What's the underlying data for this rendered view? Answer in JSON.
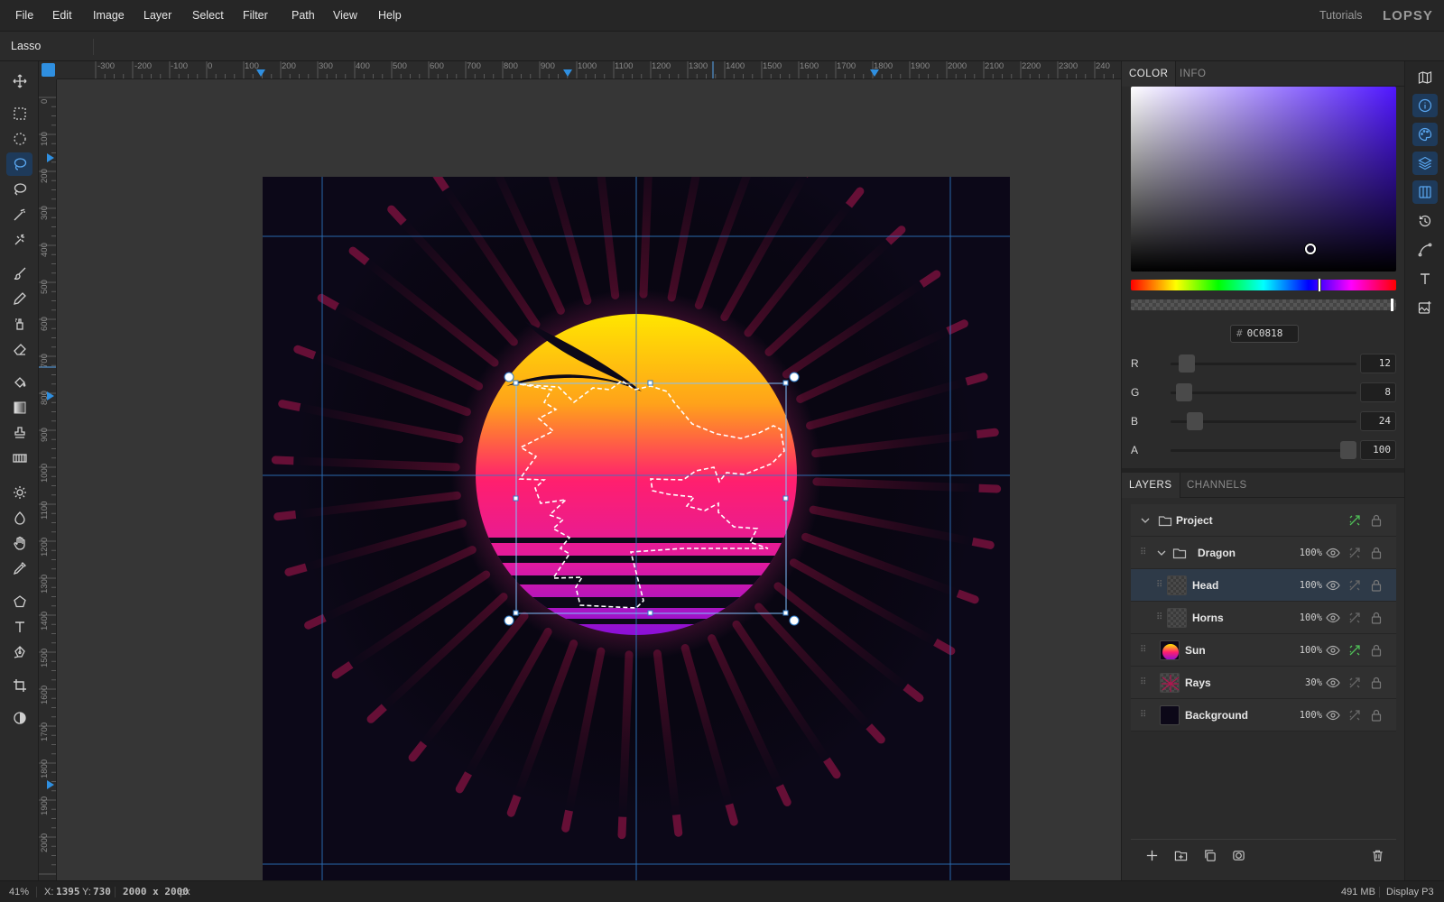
{
  "menu": {
    "items": [
      "File",
      "Edit",
      "Image",
      "Layer",
      "Select",
      "Filter",
      "Path",
      "View",
      "Help"
    ],
    "tutorials": "Tutorials",
    "brand": "LOPSY"
  },
  "options": {
    "tool_name": "Lasso"
  },
  "tools": [
    {
      "name": "move-tool",
      "icon": "move-icon"
    },
    {
      "name": "rect-select-tool",
      "icon": "rect-select-icon"
    },
    {
      "name": "ellipse-select-tool",
      "icon": "ellipse-select-icon"
    },
    {
      "name": "lasso-tool",
      "icon": "lasso-icon",
      "active": true
    },
    {
      "name": "magnetic-lasso-tool",
      "icon": "magnetic-lasso-icon"
    },
    {
      "name": "magic-wand-tool",
      "icon": "magic-wand-icon"
    },
    {
      "name": "quick-select-tool",
      "icon": "quick-select-icon"
    },
    {
      "name": "brush-tool",
      "icon": "brush-icon"
    },
    {
      "name": "pencil-tool",
      "icon": "pencil-icon"
    },
    {
      "name": "clone-tool",
      "icon": "clone-icon"
    },
    {
      "name": "eraser-tool",
      "icon": "eraser-icon"
    },
    {
      "name": "bucket-tool",
      "icon": "bucket-icon"
    },
    {
      "name": "gradient-tool",
      "icon": "gradient-icon"
    },
    {
      "name": "stamp-tool",
      "icon": "stamp-icon"
    },
    {
      "name": "pattern-tool",
      "icon": "pattern-icon"
    },
    {
      "name": "dodge-tool",
      "icon": "dodge-icon"
    },
    {
      "name": "burn-tool",
      "icon": "burn-icon"
    },
    {
      "name": "hand-tool",
      "icon": "hand-icon"
    },
    {
      "name": "eyedropper-tool",
      "icon": "eyedropper-icon"
    },
    {
      "name": "shape-tool",
      "icon": "polygon-icon"
    },
    {
      "name": "text-tool",
      "icon": "text-icon"
    },
    {
      "name": "pen-tool",
      "icon": "pen-icon"
    },
    {
      "name": "crop-tool",
      "icon": "crop-icon"
    },
    {
      "name": "contrast-tool",
      "icon": "contrast-icon"
    }
  ],
  "rulers": {
    "h": [
      "-300",
      "-200",
      "-100",
      "0",
      "100",
      "200",
      "300",
      "400",
      "500",
      "600",
      "700",
      "800",
      "900",
      "1000",
      "1100",
      "1200",
      "1300",
      "1400",
      "1500",
      "1600",
      "1700",
      "1800",
      "1900",
      "2000",
      "2100",
      "2200",
      "2300",
      "240"
    ],
    "v": [
      "0",
      "100",
      "200",
      "300",
      "400",
      "500",
      "600",
      "700",
      "800",
      "900",
      "1000",
      "1100",
      "1200",
      "1300",
      "1400",
      "1500",
      "1600",
      "1700",
      "1800",
      "1900",
      "2000"
    ]
  },
  "color_panel": {
    "tabs": [
      "COLOR",
      "INFO"
    ],
    "hex": "0C0818",
    "channels": [
      {
        "label": "R",
        "value": "12",
        "fraction": 0.047
      },
      {
        "label": "G",
        "value": "8",
        "fraction": 0.031
      },
      {
        "label": "B",
        "value": "24",
        "fraction": 0.094
      },
      {
        "label": "A",
        "value": "100",
        "fraction": 1.0
      }
    ]
  },
  "layers_panel": {
    "tabs": [
      "LAYERS",
      "CHANNELS"
    ],
    "layers": [
      {
        "name": "Project",
        "opacity": "",
        "type": "group",
        "depth": 0
      },
      {
        "name": "Dragon",
        "opacity": "100%",
        "type": "group",
        "depth": 1
      },
      {
        "name": "Head",
        "opacity": "100%",
        "type": "layer",
        "depth": 2,
        "selected": true
      },
      {
        "name": "Horns",
        "opacity": "100%",
        "type": "layer",
        "depth": 2
      },
      {
        "name": "Sun",
        "opacity": "100%",
        "type": "layer",
        "depth": 0
      },
      {
        "name": "Rays",
        "opacity": "30%",
        "type": "layer",
        "depth": 0
      },
      {
        "name": "Background",
        "opacity": "100%",
        "type": "layer",
        "depth": 0
      }
    ]
  },
  "status": {
    "zoom": "41%",
    "x_label": "X:",
    "x_value": "1395",
    "y_label": "Y:",
    "y_value": "730",
    "doc_size": "2000 x 2000",
    "doc_unit": "px",
    "memory": "491 MB",
    "color_profile": "Display P3"
  },
  "colors": {
    "accent": "#2f8fe0",
    "canvas_bg": "#0c0818",
    "selected_layer": "#2e3a48"
  }
}
